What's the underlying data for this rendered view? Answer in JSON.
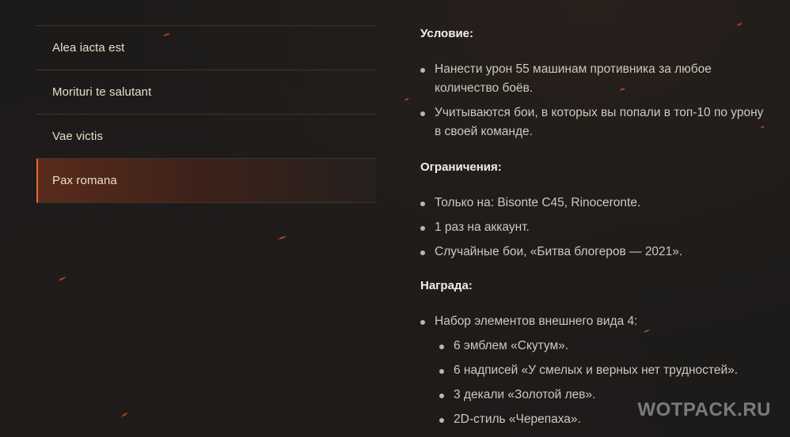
{
  "tabs": [
    {
      "label": "Alea iacta est"
    },
    {
      "label": "Morituri te salutant"
    },
    {
      "label": "Vae victis"
    },
    {
      "label": "Pax romana"
    }
  ],
  "active_tab": "Pax romana",
  "content": {
    "condition": {
      "title": "Условие:",
      "items": [
        "Нанести урон 55 машинам противника за любое количество боёв.",
        "Учитываются бои, в которых вы попали в топ-10 по урону в своей команде."
      ]
    },
    "restrictions": {
      "title": "Ограничения:",
      "items": [
        "Только на: Bisonte C45, Rinoceronte.",
        "1 раз на аккаунт.",
        "Случайные бои, «Битва блогеров — 2021»."
      ]
    },
    "reward": {
      "title": "Награда:",
      "item": "Набор элементов внешнего вида 4:",
      "subitems": [
        "6 эмблем «Скутум».",
        "6 надписей «У смелых и верных нет трудностей».",
        "3 декали «Золотой лев».",
        "2D-стиль «Черепаха»."
      ]
    }
  },
  "watermark": "WOTPACK.RU",
  "colors": {
    "background": "#1d1b1a",
    "accent": "#e3683c",
    "active_tab_bg": "#5a2b1c"
  }
}
